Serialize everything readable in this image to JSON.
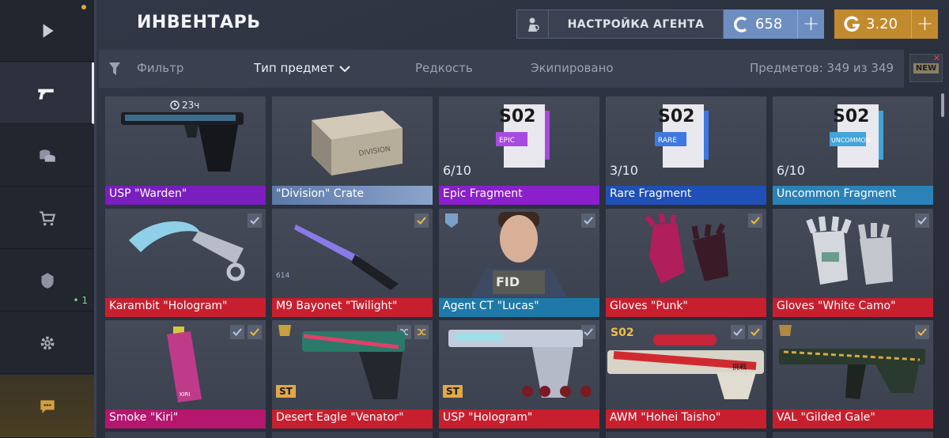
{
  "header": {
    "title": "ИНВЕНТАРЬ",
    "agent_settings": "НАСТРОЙКА АГЕНТА",
    "credits": {
      "value": "658",
      "icon": "c-coin-icon"
    },
    "gold": {
      "value": "3.20",
      "icon": "g-coin-icon"
    },
    "plus": "+"
  },
  "sidebar": {
    "items": [
      {
        "name": "play-icon"
      },
      {
        "name": "pistol-icon"
      },
      {
        "name": "coins-icon"
      },
      {
        "name": "cart-icon"
      },
      {
        "name": "clan-icon",
        "badge": "• 1"
      },
      {
        "name": "gear-icon"
      },
      {
        "name": "chat-icon"
      }
    ]
  },
  "filters": {
    "filter": "Фильтр",
    "type": "Тип предмет",
    "rarity": "Редкость",
    "equipped": "Экипировано",
    "count": "Предметов: 349 из 349",
    "new_label": "NEW",
    "new_x": "✕"
  },
  "items": [
    {
      "name": "USP \"Warden\"",
      "rarity": "purple",
      "timer": "23ч"
    },
    {
      "name": "\"Division\" Crate",
      "rarity": "crate",
      "crate_text": "DIVISION"
    },
    {
      "name": "Epic Fragment",
      "rarity": "epic",
      "count": "6/10",
      "label": "EPIC",
      "season": "S02"
    },
    {
      "name": "Rare Fragment",
      "rarity": "rare",
      "count": "3/10",
      "label": "RARE",
      "season": "S02"
    },
    {
      "name": "Uncommon Fragment",
      "rarity": "unc",
      "count": "6/10",
      "label": "UNCOMMON",
      "season": "S02"
    },
    {
      "name": "Karambit \"Hologram\"",
      "rarity": "red",
      "checks": [
        "blue"
      ]
    },
    {
      "name": "M9 Bayonet \"Twilight\"",
      "rarity": "red",
      "checks": [
        "gold"
      ],
      "stat": "614"
    },
    {
      "name": "Agent CT \"Lucas\"",
      "rarity": "teal",
      "checks": [
        "blue"
      ],
      "patch": "FID"
    },
    {
      "name": "Gloves \"Punk\"",
      "rarity": "red",
      "checks": [
        "gold"
      ]
    },
    {
      "name": "Gloves \"White Camo\"",
      "rarity": "red",
      "checks": [
        "blue"
      ]
    },
    {
      "name": "Smoke \"Kiri\"",
      "rarity": "pink",
      "checks": [
        "blue",
        "gold"
      ],
      "can_text": "KIRI"
    },
    {
      "name": "Desert Eagle \"Venator\"",
      "rarity": "red",
      "checks": [
        "blue",
        "gold"
      ],
      "st": "ST"
    },
    {
      "name": "USP \"Hologram\"",
      "rarity": "red",
      "checks": [
        "blue"
      ],
      "st": "ST"
    },
    {
      "name": "AWM \"Hohei Taisho\"",
      "rarity": "red",
      "checks": [
        "blue",
        "gold"
      ],
      "season": "S02",
      "sticker_text": "挑戦"
    },
    {
      "name": "VAL \"Gilded Gale\"",
      "rarity": "red",
      "checks": [
        "gold"
      ]
    }
  ],
  "colors": {
    "accent_gold": "#c18a2e",
    "accent_blue": "#6e8ec2",
    "red": "#c81f2f",
    "purple": "#7a1ec0"
  }
}
